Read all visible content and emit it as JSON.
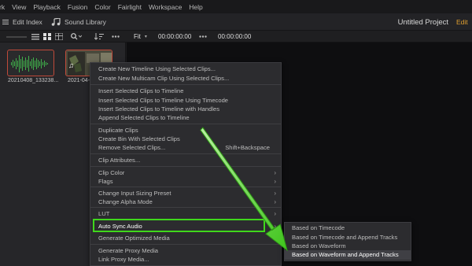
{
  "menubar": {
    "items": [
      "rk",
      "View",
      "Playback",
      "Fusion",
      "Color",
      "Fairlight",
      "Workspace",
      "Help"
    ]
  },
  "toolbar": {
    "edit_index_label": "Edit Index",
    "sound_library_label": "Sound Library",
    "project_title": "Untitled Project",
    "edit_tab_label": "Edit"
  },
  "viewer_bar": {
    "zoom": "Fit",
    "timecode": "00:00:00:00",
    "timecode2": "00:00:00:00"
  },
  "media_pool": {
    "clips": [
      {
        "name": "20210408_133238...",
        "kind": "audio"
      },
      {
        "name": "2021-04-...",
        "kind": "video"
      }
    ]
  },
  "context_menu": {
    "items": [
      {
        "label": "Create New Timeline Using Selected Clips...",
        "shortcut": "",
        "submenu": false
      },
      {
        "label": "Create New Multicam Clip Using Selected Clips...",
        "shortcut": "",
        "submenu": false
      },
      {
        "label": "Insert Selected Clips to Timeline",
        "shortcut": "",
        "submenu": false
      },
      {
        "label": "Insert Selected Clips to Timeline Using Timecode",
        "shortcut": "",
        "submenu": false
      },
      {
        "label": "Insert Selected Clips to Timeline with Handles",
        "shortcut": "",
        "submenu": false
      },
      {
        "label": "Append Selected Clips to Timeline",
        "shortcut": "",
        "submenu": false
      },
      {
        "label": "Duplicate Clips",
        "shortcut": "",
        "submenu": false
      },
      {
        "label": "Create Bin With Selected Clips",
        "shortcut": "",
        "submenu": false
      },
      {
        "label": "Remove Selected Clips...",
        "shortcut": "Shift+Backspace",
        "submenu": false
      },
      {
        "label": "Clip Attributes...",
        "shortcut": "",
        "submenu": false
      },
      {
        "label": "Clip Color",
        "shortcut": "",
        "submenu": true
      },
      {
        "label": "Flags",
        "shortcut": "",
        "submenu": true
      },
      {
        "label": "Change Input Sizing Preset",
        "shortcut": "",
        "submenu": true
      },
      {
        "label": "Change Alpha Mode",
        "shortcut": "",
        "submenu": true
      },
      {
        "label": "LUT",
        "shortcut": "",
        "submenu": true
      },
      {
        "label": "Auto Sync Audio",
        "shortcut": "",
        "submenu": true
      },
      {
        "label": "Generate Optimized Media",
        "shortcut": "",
        "submenu": false
      },
      {
        "label": "Generate Proxy Media",
        "shortcut": "",
        "submenu": false
      },
      {
        "label": "Link Proxy Media...",
        "shortcut": "",
        "submenu": false
      }
    ]
  },
  "submenu": {
    "items": [
      "Based on Timecode",
      "Based on Timecode and Append Tracks",
      "Based on Waveform",
      "Based on Waveform and Append Tracks"
    ]
  },
  "colors": {
    "annotation_green": "#3fd71c",
    "clip_border": "#c04a3a",
    "edit_accent": "#e0a030"
  }
}
